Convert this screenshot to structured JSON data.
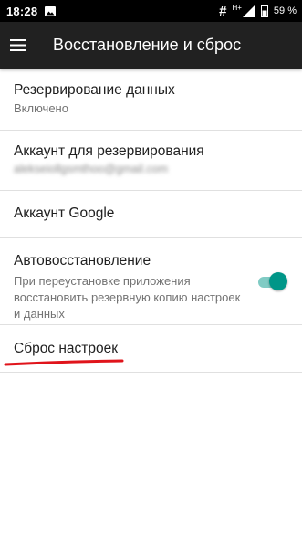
{
  "status_bar": {
    "time": "18:28",
    "hash_symbol": "#",
    "network_label": "H+",
    "battery_percent": "59 %"
  },
  "app_bar": {
    "title": "Восстановление и сброс",
    "menu_icon": "hamburger-menu-icon"
  },
  "settings": {
    "items": [
      {
        "title": "Резервирование данных",
        "subtitle": "Включено"
      },
      {
        "title": "Аккаунт для резервирования",
        "subtitle": "alekseiollgsmthoo@gmail.com"
      },
      {
        "title": "Аккаунт Google"
      },
      {
        "title": "Автовосстановление",
        "summary": "При переустановке приложения восстановить резервную копию настроек и данных",
        "switch_on": true
      },
      {
        "title": "Сброс настроек"
      }
    ]
  },
  "colors": {
    "app_bar": "#212121",
    "accent": "#009688",
    "underline": "#e0141b"
  }
}
